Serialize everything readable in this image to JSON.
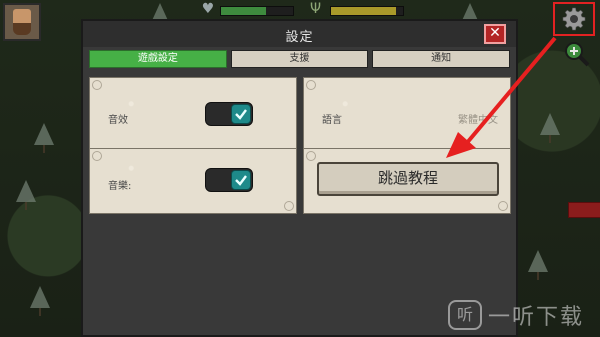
{
  "hud": {
    "health_level": 0.62,
    "hunger_level": 0.9
  },
  "modal": {
    "title": "設定",
    "close_label": "✕",
    "tabs": [
      {
        "label": "遊戲設定",
        "active": true
      },
      {
        "label": "支援",
        "active": false
      },
      {
        "label": "通知",
        "active": false
      }
    ],
    "sound_effects_label": "音效",
    "music_label": "音樂:",
    "language_label": "語言",
    "language_value": "繁體中文",
    "skip_tutorial_label": "跳過教程"
  },
  "watermark": {
    "logo_text": "听",
    "text": "一听下载"
  },
  "colors": {
    "active_tab": "#46b046",
    "highlight": "#e22222",
    "toggle_on": "#1e8a8a"
  },
  "icons": {
    "settings": "gear-icon",
    "zoom": "zoom-in-icon",
    "close": "close-icon",
    "check": "check-icon",
    "health": "heart-icon",
    "hunger": "fork-icon"
  }
}
